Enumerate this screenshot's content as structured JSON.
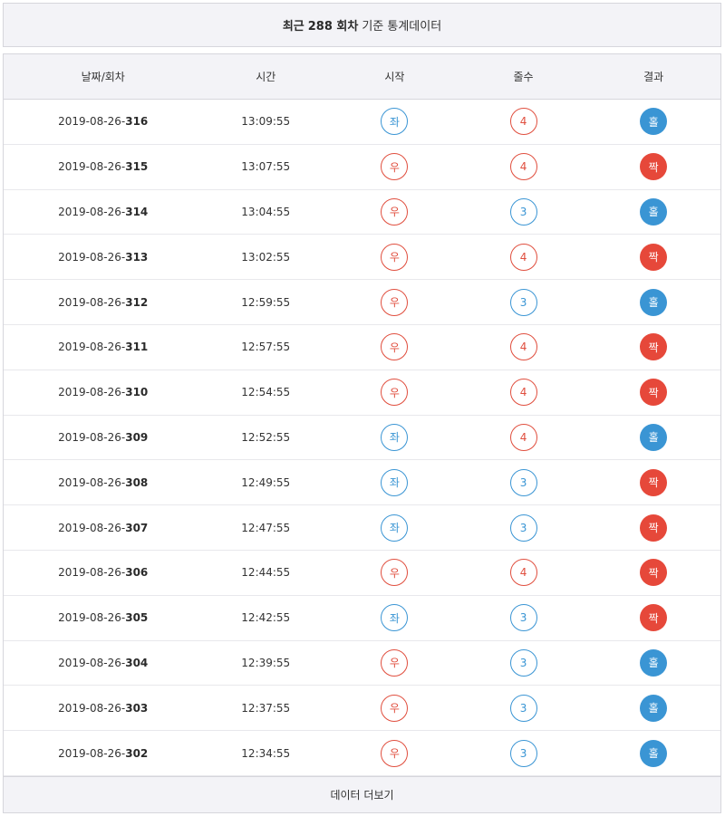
{
  "header": {
    "prefix": "최근",
    "count": "288 회차",
    "suffix": "기준 통계데이터"
  },
  "columns": [
    "날짜/회차",
    "시간",
    "시작",
    "줄수",
    "결과"
  ],
  "colors": {
    "blue": "#3a95d4",
    "red": "#e6483a"
  },
  "rows": [
    {
      "date": "2019-08-26-",
      "round": "316",
      "time": "13:09:55",
      "start": "좌",
      "start_color": "blue",
      "lines": "4",
      "lines_color": "red",
      "result": "홀",
      "result_color": "blue"
    },
    {
      "date": "2019-08-26-",
      "round": "315",
      "time": "13:07:55",
      "start": "우",
      "start_color": "red",
      "lines": "4",
      "lines_color": "red",
      "result": "짝",
      "result_color": "red"
    },
    {
      "date": "2019-08-26-",
      "round": "314",
      "time": "13:04:55",
      "start": "우",
      "start_color": "red",
      "lines": "3",
      "lines_color": "blue",
      "result": "홀",
      "result_color": "blue"
    },
    {
      "date": "2019-08-26-",
      "round": "313",
      "time": "13:02:55",
      "start": "우",
      "start_color": "red",
      "lines": "4",
      "lines_color": "red",
      "result": "짝",
      "result_color": "red"
    },
    {
      "date": "2019-08-26-",
      "round": "312",
      "time": "12:59:55",
      "start": "우",
      "start_color": "red",
      "lines": "3",
      "lines_color": "blue",
      "result": "홀",
      "result_color": "blue"
    },
    {
      "date": "2019-08-26-",
      "round": "311",
      "time": "12:57:55",
      "start": "우",
      "start_color": "red",
      "lines": "4",
      "lines_color": "red",
      "result": "짝",
      "result_color": "red"
    },
    {
      "date": "2019-08-26-",
      "round": "310",
      "time": "12:54:55",
      "start": "우",
      "start_color": "red",
      "lines": "4",
      "lines_color": "red",
      "result": "짝",
      "result_color": "red"
    },
    {
      "date": "2019-08-26-",
      "round": "309",
      "time": "12:52:55",
      "start": "좌",
      "start_color": "blue",
      "lines": "4",
      "lines_color": "red",
      "result": "홀",
      "result_color": "blue"
    },
    {
      "date": "2019-08-26-",
      "round": "308",
      "time": "12:49:55",
      "start": "좌",
      "start_color": "blue",
      "lines": "3",
      "lines_color": "blue",
      "result": "짝",
      "result_color": "red"
    },
    {
      "date": "2019-08-26-",
      "round": "307",
      "time": "12:47:55",
      "start": "좌",
      "start_color": "blue",
      "lines": "3",
      "lines_color": "blue",
      "result": "짝",
      "result_color": "red"
    },
    {
      "date": "2019-08-26-",
      "round": "306",
      "time": "12:44:55",
      "start": "우",
      "start_color": "red",
      "lines": "4",
      "lines_color": "red",
      "result": "짝",
      "result_color": "red"
    },
    {
      "date": "2019-08-26-",
      "round": "305",
      "time": "12:42:55",
      "start": "좌",
      "start_color": "blue",
      "lines": "3",
      "lines_color": "blue",
      "result": "짝",
      "result_color": "red"
    },
    {
      "date": "2019-08-26-",
      "round": "304",
      "time": "12:39:55",
      "start": "우",
      "start_color": "red",
      "lines": "3",
      "lines_color": "blue",
      "result": "홀",
      "result_color": "blue"
    },
    {
      "date": "2019-08-26-",
      "round": "303",
      "time": "12:37:55",
      "start": "우",
      "start_color": "red",
      "lines": "3",
      "lines_color": "blue",
      "result": "홀",
      "result_color": "blue"
    },
    {
      "date": "2019-08-26-",
      "round": "302",
      "time": "12:34:55",
      "start": "우",
      "start_color": "red",
      "lines": "3",
      "lines_color": "blue",
      "result": "홀",
      "result_color": "blue"
    }
  ],
  "more_button": "데이터 더보기"
}
